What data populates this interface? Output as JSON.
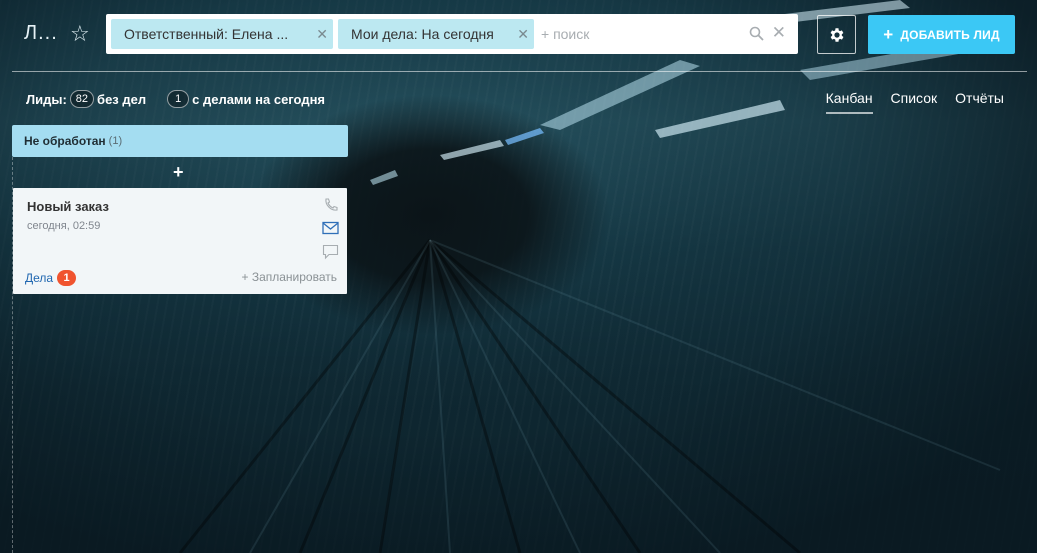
{
  "header": {
    "title": "Л...",
    "filters": [
      {
        "label": "Ответственный: Елена ..."
      },
      {
        "label": "Мои дела: На сегодня"
      }
    ],
    "search_placeholder": "+ поиск",
    "add_button_label": "ДОБАВИТЬ ЛИД"
  },
  "counters": {
    "leads_label": "Лиды:",
    "leads_count": "82",
    "leads_suffix": "без дел",
    "today_count": "1",
    "today_label": "с делами на сегодня"
  },
  "views": {
    "kanban": "Канбан",
    "list": "Список",
    "reports": "Отчёты"
  },
  "columns": [
    {
      "title": "Не обработан",
      "count": "(1)",
      "cards": [
        {
          "title": "Новый заказ",
          "date": "сегодня, 02:59",
          "deals_label": "Дела",
          "deals_count": "1",
          "plan_label": "+ Запланировать"
        }
      ]
    }
  ],
  "colors": {
    "accent": "#3bc8f5",
    "column_header": "#a4ddf1",
    "chip": "#bce8f1",
    "badge": "#f0542f",
    "link": "#2067b0"
  },
  "icons": {
    "star": "star-icon",
    "gear": "gear-icon",
    "search": "search-icon",
    "clear": "close-icon",
    "phone": "phone-icon",
    "mail": "mail-icon",
    "chat": "chat-icon"
  }
}
